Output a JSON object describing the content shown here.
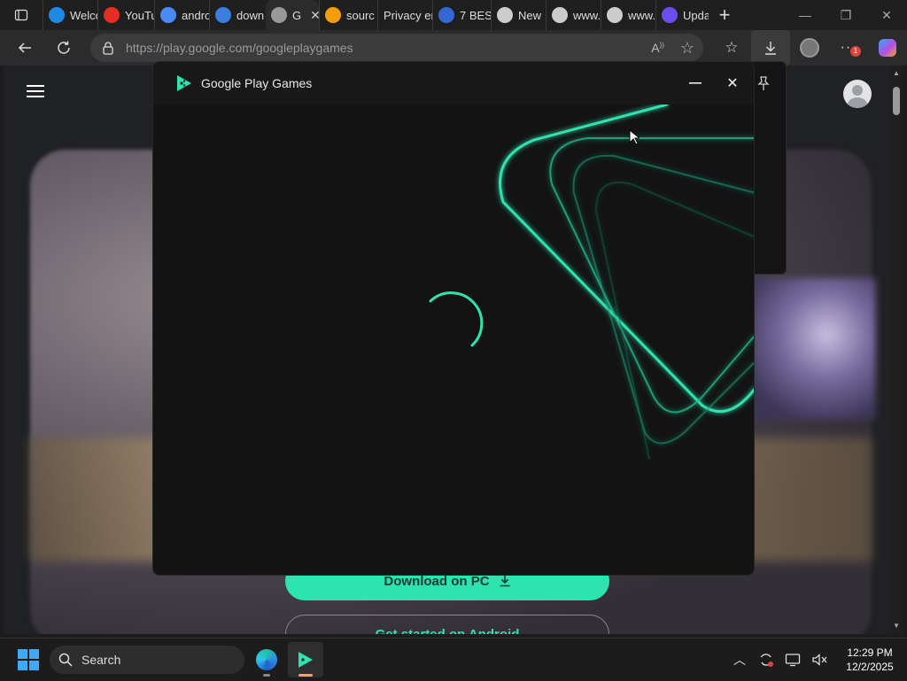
{
  "browser": {
    "tabs": [
      {
        "label": "Welco",
        "icon": "edge-icon",
        "color": "#1e88e5",
        "active": false
      },
      {
        "label": "YouTu",
        "icon": "youtube-icon",
        "color": "#e52d27",
        "active": false
      },
      {
        "label": "andro",
        "icon": "search-icon",
        "color": "#4a8af4",
        "active": false
      },
      {
        "label": "down",
        "icon": "bing-icon",
        "color": "#3b7ddd",
        "active": false
      },
      {
        "label": "G",
        "icon": "globe-icon",
        "color": "#999999",
        "active": true
      },
      {
        "label": "sourc",
        "icon": "diamond-icon",
        "color": "#f59e0b",
        "active": false
      },
      {
        "label": "Privacy en",
        "icon": "",
        "color": "#999999",
        "active": false
      },
      {
        "label": "7 BES",
        "icon": "wordpress-icon",
        "color": "#3466d6",
        "active": false
      },
      {
        "label": "New",
        "icon": "newtab-icon",
        "color": "#cccccc",
        "active": false
      },
      {
        "label": "www.",
        "icon": "document-icon",
        "color": "#cccccc",
        "active": false
      },
      {
        "label": "www.",
        "icon": "document-icon",
        "color": "#cccccc",
        "active": false
      },
      {
        "label": "Upda",
        "icon": "hexagon-icon",
        "color": "#6d4cf0",
        "active": false
      }
    ],
    "url_domain": "https://play.google.com",
    "url_path": "/googleplaygames",
    "download_badge": "1"
  },
  "gpg_window": {
    "title": "Google Play Games",
    "accent": "#2de3b0"
  },
  "page": {
    "download_label": "Download on PC",
    "android_label": "Get started on Android"
  },
  "taskbar": {
    "search_label": "Search",
    "time": "12:29 PM",
    "date": "12/2/2025"
  }
}
